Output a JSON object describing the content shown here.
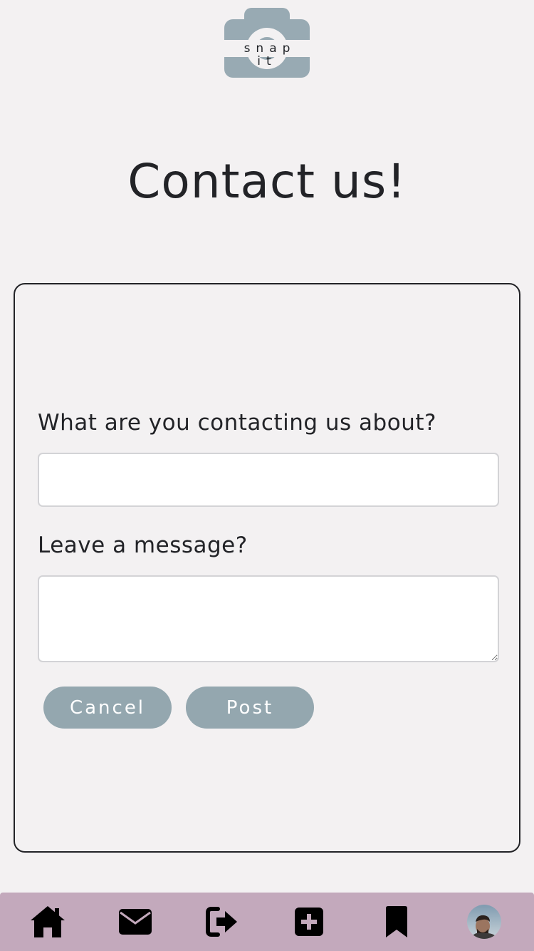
{
  "logo": {
    "text": "snap it",
    "color": "#98aab3"
  },
  "page": {
    "title": "Contact us!"
  },
  "form": {
    "subject_label": "What are you contacting us about?",
    "subject_value": "",
    "message_label": "Leave a message?",
    "message_value": "",
    "cancel_label": "Cancel",
    "post_label": "Post"
  },
  "nav": {
    "items": [
      {
        "icon": "home-icon"
      },
      {
        "icon": "mail-icon"
      },
      {
        "icon": "logout-icon"
      },
      {
        "icon": "add-post-icon"
      },
      {
        "icon": "bookmark-icon"
      },
      {
        "icon": "avatar"
      }
    ],
    "background": "#c3a9bc"
  },
  "colors": {
    "background": "#f3f1f2",
    "button": "#94a7af",
    "text": "#222327"
  }
}
